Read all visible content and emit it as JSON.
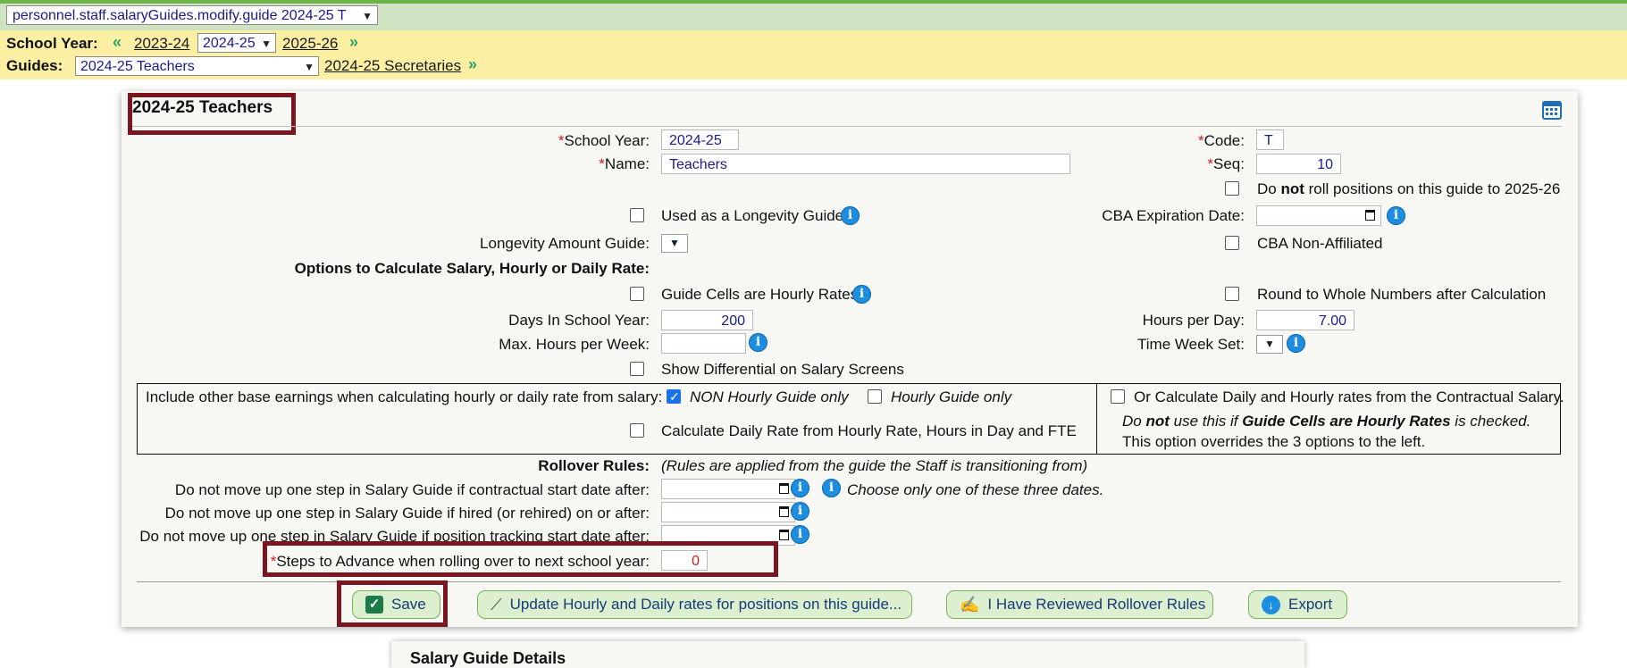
{
  "menu_select": {
    "value": "personnel.staff.salaryGuides.modify.guide 2024-25 T"
  },
  "nav": {
    "school_year_label": "School Year:",
    "prev_year": "2023-24",
    "current_year": "2024-25",
    "next_year": "2025-26",
    "guides_label": "Guides:",
    "guide_select": "2024-25 Teachers",
    "next_guide": "2024-25 Secretaries"
  },
  "panel": {
    "title": "2024-25 Teachers",
    "school_year_label": "School Year:",
    "school_year_value": "2024-25",
    "name_label": "Name:",
    "name_value": "Teachers",
    "code_label": "Code:",
    "code_value": "T",
    "seq_label": "Seq:",
    "seq_value": "10",
    "no_roll_pre": "Do",
    "no_roll_bold": "not",
    "no_roll_post": "roll positions on this guide to 2025-26",
    "longevity_guide_label": "Used as a Longevity Guide",
    "cba_expiration_label": "CBA Expiration Date:",
    "longevity_amount_label": "Longevity Amount Guide:",
    "cba_non_affiliated_label": "CBA Non-Affiliated",
    "options_heading": "Options to Calculate Salary, Hourly or Daily Rate:",
    "hourly_rates_label": "Guide Cells are Hourly Rates",
    "round_label": "Round to Whole Numbers after Calculation",
    "days_label": "Days In School Year:",
    "days_value": "200",
    "hours_day_label": "Hours per Day:",
    "hours_day_value": "7.00",
    "max_hours_label": "Max. Hours per Week:",
    "time_week_label": "Time Week Set:",
    "differential_label": "Show Differential on Salary Screens",
    "include_label": "Include other base earnings when calculating hourly or daily rate from salary:",
    "non_hourly_label": "NON Hourly Guide only",
    "hourly_only_label": "Hourly Guide only",
    "calc_daily_label": "Calculate Daily Rate from Hourly Rate, Hours in Day and FTE",
    "contractual_label": "Or Calculate Daily and Hourly rates from the Contractual Salary.",
    "note_pre": "Do",
    "note_not": "not",
    "note_mid": "use this if",
    "note_bold": "Guide Cells are Hourly Rates",
    "note_post": "is checked.",
    "overrides_note": "This option overrides the 3 options to the left.",
    "rollover_label": "Rollover Rules:",
    "rollover_note": "(Rules are applied from the guide the Staff is transitioning from)",
    "rule1_label": "Do not move up one step in Salary Guide if contractual start date after:",
    "rule2_label": "Do not move up one step in Salary Guide if hired (or rehired) on or after:",
    "rule3_label": "Do not move up one step in Salary Guide if position tracking start date after:",
    "choose_note": "Choose only one of these three dates.",
    "steps_label": "Steps to Advance when rolling over to next school year:",
    "steps_value": "0"
  },
  "buttons": {
    "save": "Save",
    "update_rates": "Update Hourly and Daily rates for positions on this guide...",
    "reviewed": "I Have Reviewed Rollover Rules",
    "export": "Export"
  },
  "next_section_title": "Salary Guide Details",
  "colors": {
    "accent_green": "#dcefcf",
    "highlight_red": "#7b1520",
    "yellow_bar": "#fbefa4"
  }
}
